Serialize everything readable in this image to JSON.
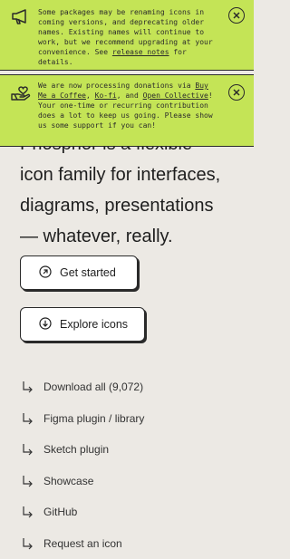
{
  "banner_updates": {
    "icon": "megaphone-icon",
    "text_before_link": "Some packages may be renaming icons in coming versions, and deprecating older names. Existing names will continue to work, but we recommend upgrading at your convenience. See ",
    "link": "release notes",
    "text_after_link": " for details.",
    "close_icon": "close-circle-icon"
  },
  "banner_donations": {
    "icon": "hand-heart-icon",
    "t1": "We are now processing donations via ",
    "link1": "Buy Me a Coffee",
    "t2": ", ",
    "link2": "Ko-fi",
    "t3": ", and ",
    "link3": "Open Collective",
    "t4": "! Your one-time or recurring contribution does a lot to keep us going. Please show us some support if you can!",
    "close_icon": "close-circle-icon"
  },
  "hero": {
    "line0": "Phosphor is a flexible",
    "line1": "icon family for interfaces,",
    "line2": "diagrams, presentations",
    "line3": "— whatever, really."
  },
  "buttons": {
    "get_started": "Get started",
    "explore": "Explore icons"
  },
  "links": [
    "Download all (9,072)",
    "Figma plugin / library",
    "Sketch plugin",
    "Showcase",
    "GitHub",
    "Request an icon"
  ],
  "colors": {
    "banner": "#c4e456",
    "background": "#ece9e4",
    "text": "#222222"
  }
}
